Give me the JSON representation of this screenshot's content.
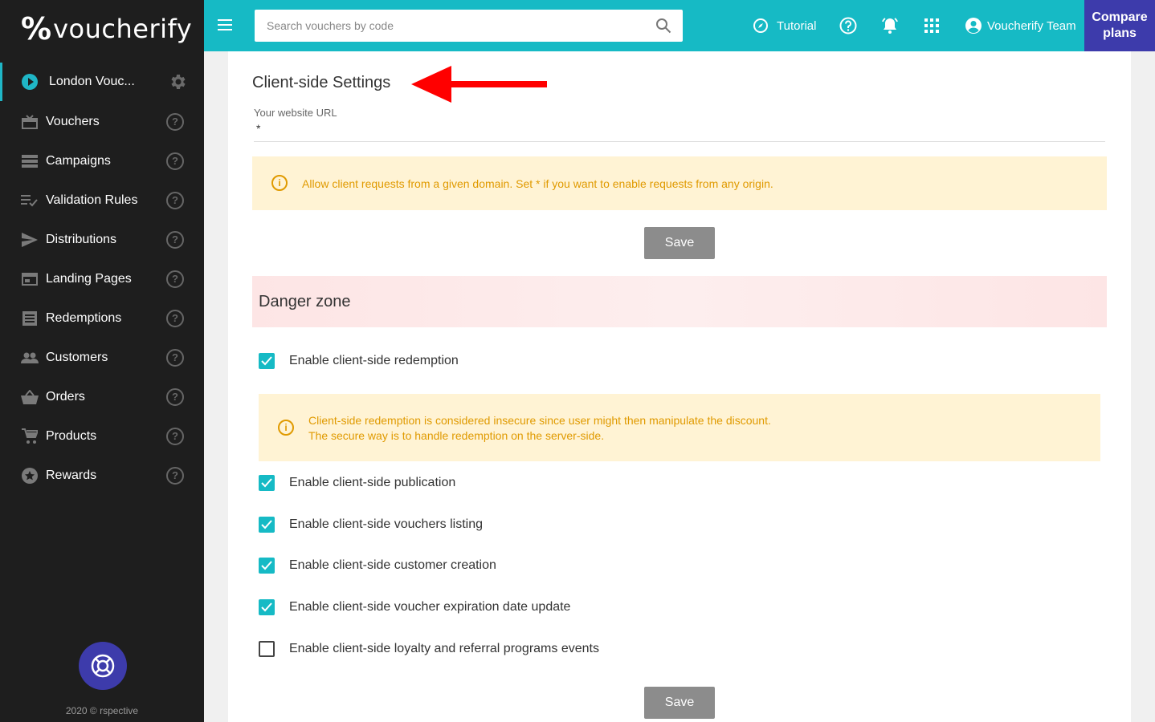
{
  "brand": {
    "symbol": "%",
    "name": "voucherify"
  },
  "project": {
    "name": "London Vouc..."
  },
  "sidebar": {
    "items": [
      {
        "label": "Vouchers",
        "icon": "voucher-icon"
      },
      {
        "label": "Campaigns",
        "icon": "campaigns-icon"
      },
      {
        "label": "Validation Rules",
        "icon": "rules-icon"
      },
      {
        "label": "Distributions",
        "icon": "send-icon"
      },
      {
        "label": "Landing Pages",
        "icon": "landing-page-icon"
      },
      {
        "label": "Redemptions",
        "icon": "redemptions-icon"
      },
      {
        "label": "Customers",
        "icon": "customers-icon"
      },
      {
        "label": "Orders",
        "icon": "basket-icon"
      },
      {
        "label": "Products",
        "icon": "cart-icon"
      },
      {
        "label": "Rewards",
        "icon": "star-icon"
      }
    ],
    "help_glyph": "?",
    "copyright": "2020 © rspective"
  },
  "topbar": {
    "search_placeholder": "Search vouchers by code",
    "tutorial": "Tutorial",
    "user": "Voucherify Team",
    "compare_line1": "Compare",
    "compare_line2": "plans"
  },
  "client_settings": {
    "title": "Client-side Settings",
    "url_label": "Your website URL",
    "url_value": "*",
    "info": "Allow client requests from a given domain. Set * if you want to enable requests from any origin.",
    "save": "Save"
  },
  "danger_zone": {
    "title": "Danger zone",
    "warning_line1": "Client-side redemption is considered insecure since user might then manipulate the discount.",
    "warning_line2": "The secure way is to handle redemption on the server-side.",
    "options": [
      {
        "label": "Enable client-side redemption",
        "checked": true
      },
      {
        "label": "Enable client-side publication",
        "checked": true
      },
      {
        "label": "Enable client-side vouchers listing",
        "checked": true
      },
      {
        "label": "Enable client-side customer creation",
        "checked": true
      },
      {
        "label": "Enable client-side voucher expiration date update",
        "checked": true
      },
      {
        "label": "Enable client-side loyalty and referral programs events",
        "checked": false
      }
    ],
    "save": "Save"
  },
  "colors": {
    "accent": "#16bac5",
    "purple": "#3d3bab",
    "warning_bg": "#fff3d4",
    "warning_text": "#e09a00",
    "sidebar_bg": "#1e1e1e"
  }
}
